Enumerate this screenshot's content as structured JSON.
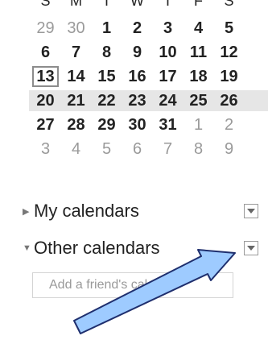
{
  "mini_calendar": {
    "weekday_headers": [
      "S",
      "M",
      "T",
      "W",
      "T",
      "F",
      "S"
    ],
    "weeks": [
      [
        {
          "d": "29",
          "other": true
        },
        {
          "d": "30",
          "other": true
        },
        {
          "d": "1"
        },
        {
          "d": "2"
        },
        {
          "d": "3"
        },
        {
          "d": "4"
        },
        {
          "d": "5"
        }
      ],
      [
        {
          "d": "6"
        },
        {
          "d": "7"
        },
        {
          "d": "8"
        },
        {
          "d": "9"
        },
        {
          "d": "10"
        },
        {
          "d": "11"
        },
        {
          "d": "12"
        }
      ],
      [
        {
          "d": "13",
          "today": true
        },
        {
          "d": "14"
        },
        {
          "d": "15"
        },
        {
          "d": "16"
        },
        {
          "d": "17"
        },
        {
          "d": "18"
        },
        {
          "d": "19"
        }
      ],
      [
        {
          "d": "20"
        },
        {
          "d": "21"
        },
        {
          "d": "22"
        },
        {
          "d": "23"
        },
        {
          "d": "24"
        },
        {
          "d": "25"
        },
        {
          "d": "26"
        }
      ],
      [
        {
          "d": "27"
        },
        {
          "d": "28"
        },
        {
          "d": "29"
        },
        {
          "d": "30"
        },
        {
          "d": "31"
        },
        {
          "d": "1",
          "other": true
        },
        {
          "d": "2",
          "other": true
        }
      ],
      [
        {
          "d": "3",
          "other": true
        },
        {
          "d": "4",
          "other": true
        },
        {
          "d": "5",
          "other": true
        },
        {
          "d": "6",
          "other": true
        },
        {
          "d": "7",
          "other": true
        },
        {
          "d": "8",
          "other": true
        },
        {
          "d": "9",
          "other": true
        }
      ]
    ],
    "highlighted_week": 3
  },
  "sections": {
    "my_calendars": {
      "label": "My calendars",
      "expanded": false
    },
    "other_calendars": {
      "label": "Other calendars",
      "expanded": true
    }
  },
  "friend_input": {
    "placeholder": "Add a friend's calendar"
  },
  "colors": {
    "annotation_arrow_fill": "#9ecbff",
    "annotation_arrow_stroke": "#1f2f6e"
  }
}
